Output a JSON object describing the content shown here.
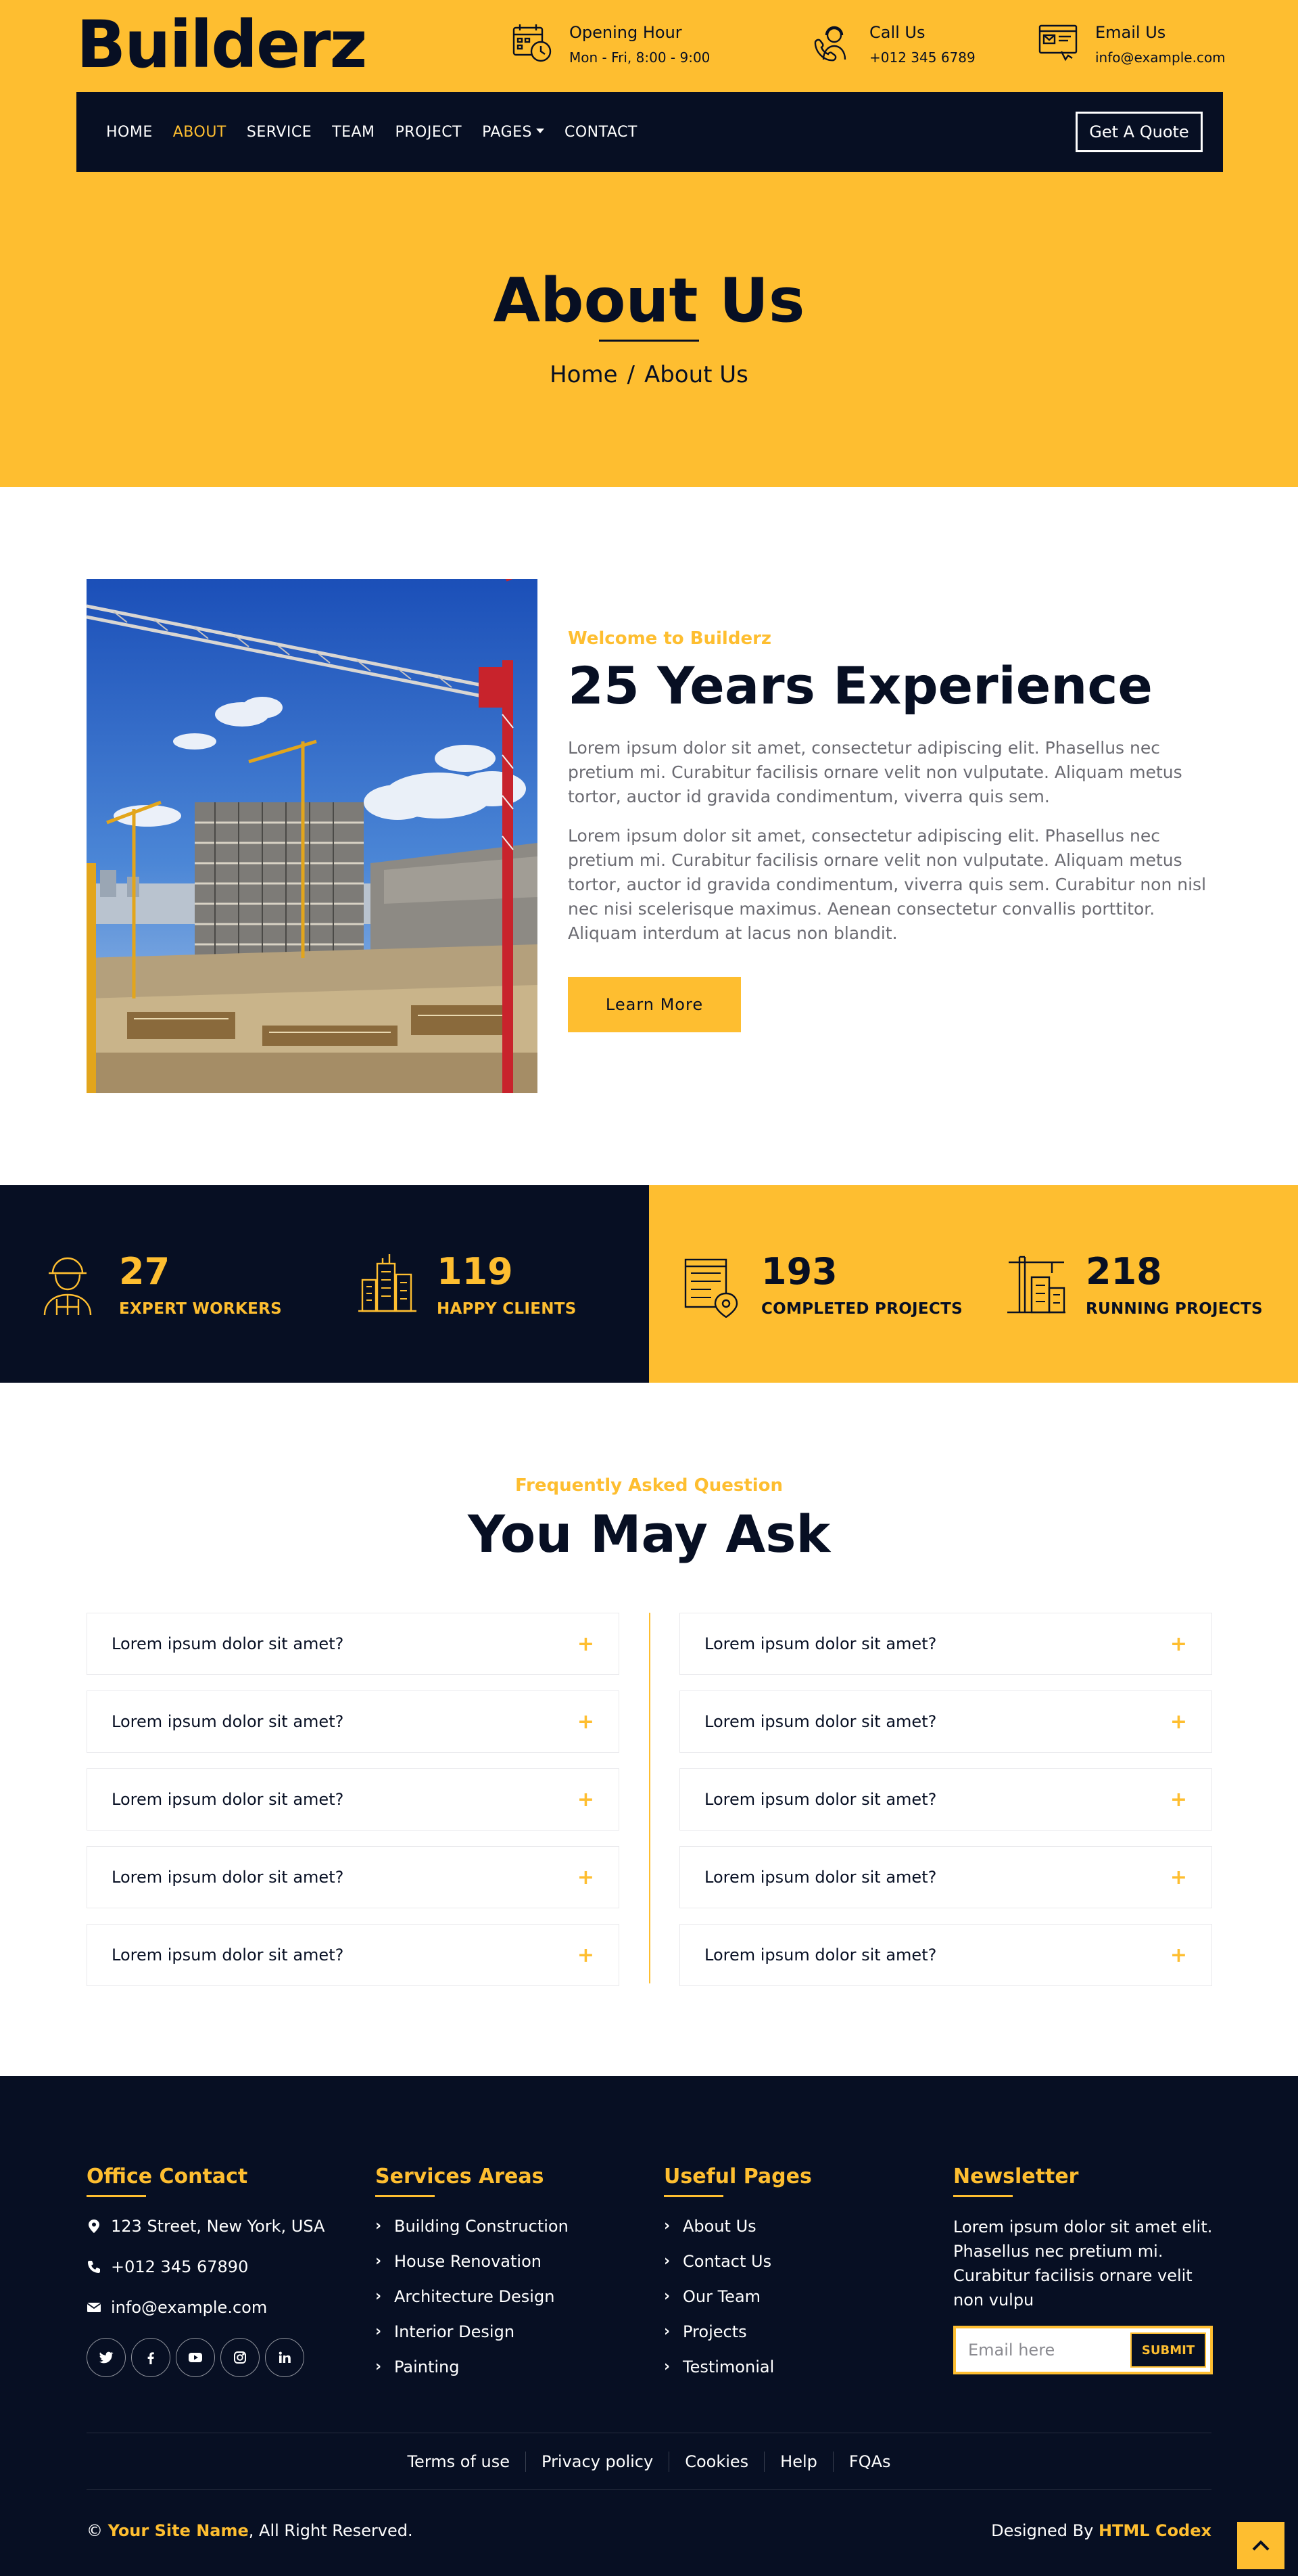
{
  "brand": {
    "name": "Builderz"
  },
  "colors": {
    "accent": "#FEBE30",
    "dark": "#070F23",
    "text_gray": "#6b6b72"
  },
  "header": {
    "info": [
      {
        "icon": "calendar-clock-icon",
        "label": "Opening Hour",
        "value": "Mon - Fri, 8:00 - 9:00"
      },
      {
        "icon": "call-center-icon",
        "label": "Call Us",
        "value": "+012 345 6789"
      },
      {
        "icon": "email-icon",
        "label": "Email Us",
        "value": "info@example.com"
      }
    ]
  },
  "nav": {
    "items": [
      "HOME",
      "ABOUT",
      "SERVICE",
      "TEAM",
      "PROJECT",
      "PAGES",
      "CONTACT"
    ],
    "active": "ABOUT",
    "quote_label": "Get A Quote"
  },
  "hero": {
    "title": "About Us",
    "crumb_home": "Home",
    "crumb_sep": "/",
    "crumb_current": "About Us"
  },
  "about": {
    "eyebrow": "Welcome to Builderz",
    "title": "25 Years Experience",
    "p1": "Lorem ipsum dolor sit amet, consectetur adipiscing elit. Phasellus nec pretium mi. Curabitur facilisis ornare velit non vulputate. Aliquam metus tortor, auctor id gravida condimentum, viverra quis sem.",
    "p2": "Lorem ipsum dolor sit amet, consectetur adipiscing elit. Phasellus nec pretium mi. Curabitur facilisis ornare velit non vulputate. Aliquam metus tortor, auctor id gravida condimentum, viverra quis sem. Curabitur non nisl nec nisi scelerisque maximus. Aenean consectetur convallis porttitor. Aliquam interdum at lacus non blandit.",
    "button": "Learn More",
    "image_alt": "construction-site-photo"
  },
  "stats": [
    {
      "icon": "worker-icon",
      "value": "27",
      "label": "Expert Workers"
    },
    {
      "icon": "buildings-icon",
      "value": "119",
      "label": "Happy Clients"
    },
    {
      "icon": "building-location-icon",
      "value": "193",
      "label": "Completed Projects"
    },
    {
      "icon": "crane-building-icon",
      "value": "218",
      "label": "Running Projects"
    }
  ],
  "faq": {
    "eyebrow": "Frequently Asked Question",
    "title": "You May Ask",
    "left": [
      "Lorem ipsum dolor sit amet?",
      "Lorem ipsum dolor sit amet?",
      "Lorem ipsum dolor sit amet?",
      "Lorem ipsum dolor sit amet?",
      "Lorem ipsum dolor sit amet?"
    ],
    "right": [
      "Lorem ipsum dolor sit amet?",
      "Lorem ipsum dolor sit amet?",
      "Lorem ipsum dolor sit amet?",
      "Lorem ipsum dolor sit amet?",
      "Lorem ipsum dolor sit amet?"
    ],
    "toggle": "+"
  },
  "footer": {
    "contact": {
      "title": "Office Contact",
      "address": "123 Street, New York, USA",
      "phone": "+012 345 67890",
      "email": "info@example.com",
      "socials": [
        "twitter-icon",
        "facebook-icon",
        "youtube-icon",
        "instagram-icon",
        "linkedin-icon"
      ]
    },
    "services": {
      "title": "Services Areas",
      "items": [
        "Building Construction",
        "House Renovation",
        "Architecture Design",
        "Interior Design",
        "Painting"
      ]
    },
    "pages": {
      "title": "Useful Pages",
      "items": [
        "About Us",
        "Contact Us",
        "Our Team",
        "Projects",
        "Testimonial"
      ]
    },
    "newsletter": {
      "title": "Newsletter",
      "text": "Lorem ipsum dolor sit amet elit. Phasellus nec pretium mi. Curabitur facilisis ornare velit non vulpu",
      "placeholder": "Email here",
      "button": "SUBMIT"
    },
    "bottom_links": [
      "Terms of use",
      "Privacy policy",
      "Cookies",
      "Help",
      "FQAs"
    ],
    "copyright_prefix": "©",
    "site_name": "Your Site Name",
    "copyright_suffix": ", All Right Reserved.",
    "designed_by_label": "Designed By",
    "designer": "HTML Codex"
  }
}
